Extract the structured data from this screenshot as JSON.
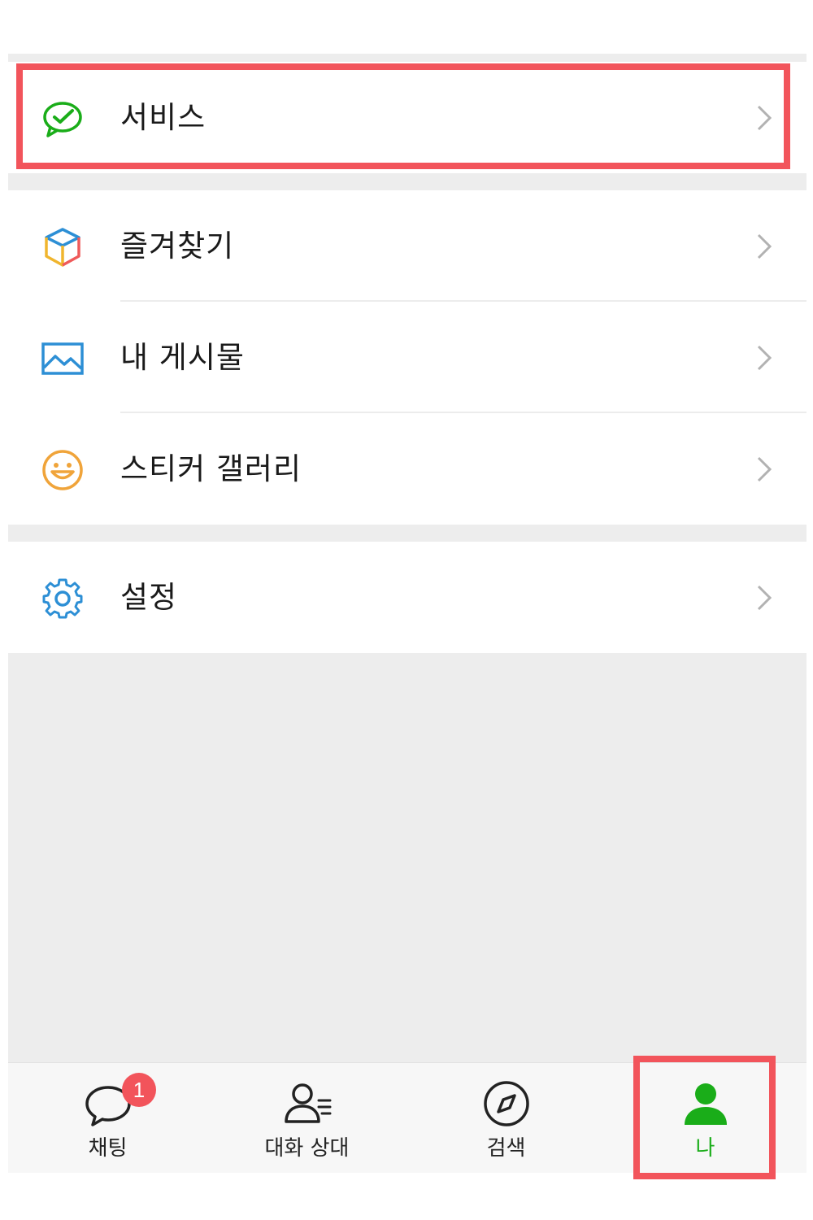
{
  "menu": {
    "services": {
      "label": "서비스",
      "icon": "chat-check-icon"
    },
    "favorites": {
      "label": "즐겨찾기",
      "icon": "cube-icon"
    },
    "posts": {
      "label": "내 게시물",
      "icon": "image-icon"
    },
    "stickers": {
      "label": "스티커 갤러리",
      "icon": "smiley-icon"
    },
    "settings": {
      "label": "설정",
      "icon": "gear-icon"
    }
  },
  "tabbar": {
    "chats": {
      "label": "채팅",
      "badge": "1",
      "icon": "chat-bubble-icon"
    },
    "contacts": {
      "label": "대화 상대",
      "icon": "contacts-icon"
    },
    "discover": {
      "label": "검색",
      "icon": "compass-icon"
    },
    "me": {
      "label": "나",
      "icon": "person-icon",
      "active": true
    }
  },
  "colors": {
    "accent": "#1aad19",
    "highlight": "#f2545b",
    "background": "#ededed"
  }
}
